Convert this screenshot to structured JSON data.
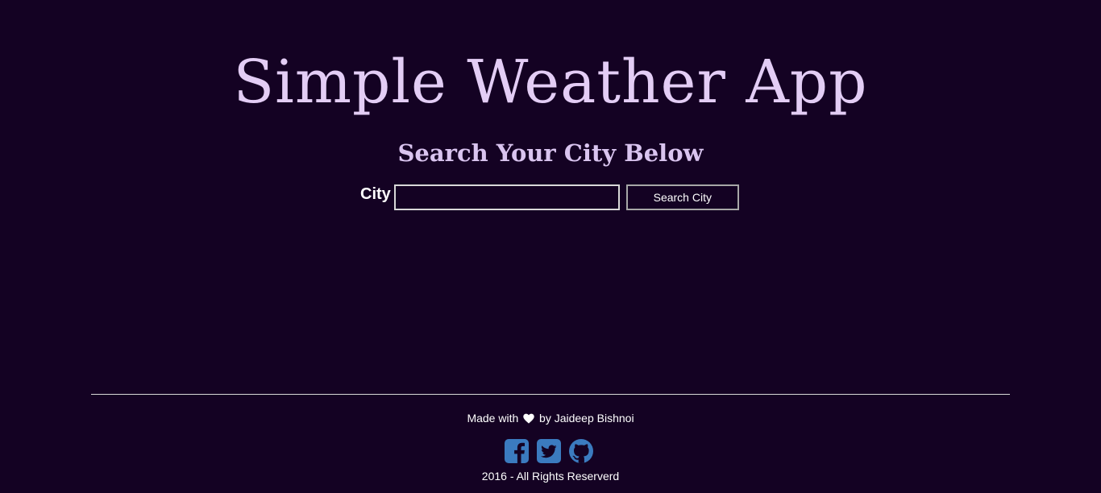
{
  "header": {
    "title": "Simple Weather App",
    "subtitle": "Search Your City Below"
  },
  "search": {
    "label": "City",
    "input_value": "",
    "placeholder": "",
    "button_label": "Search City"
  },
  "footer": {
    "made_prefix": "Made with",
    "made_suffix": "by Jaideep Bishnoi",
    "heart_icon": "heart-icon",
    "social_icons": [
      "facebook-icon",
      "twitter-icon",
      "github-icon"
    ],
    "social_color": "#3b7bbf",
    "copyright": "2016 - All Rights Reserverd"
  },
  "colors": {
    "background": "#140223",
    "title": "#e3cdf5",
    "text": "#ffffff"
  }
}
